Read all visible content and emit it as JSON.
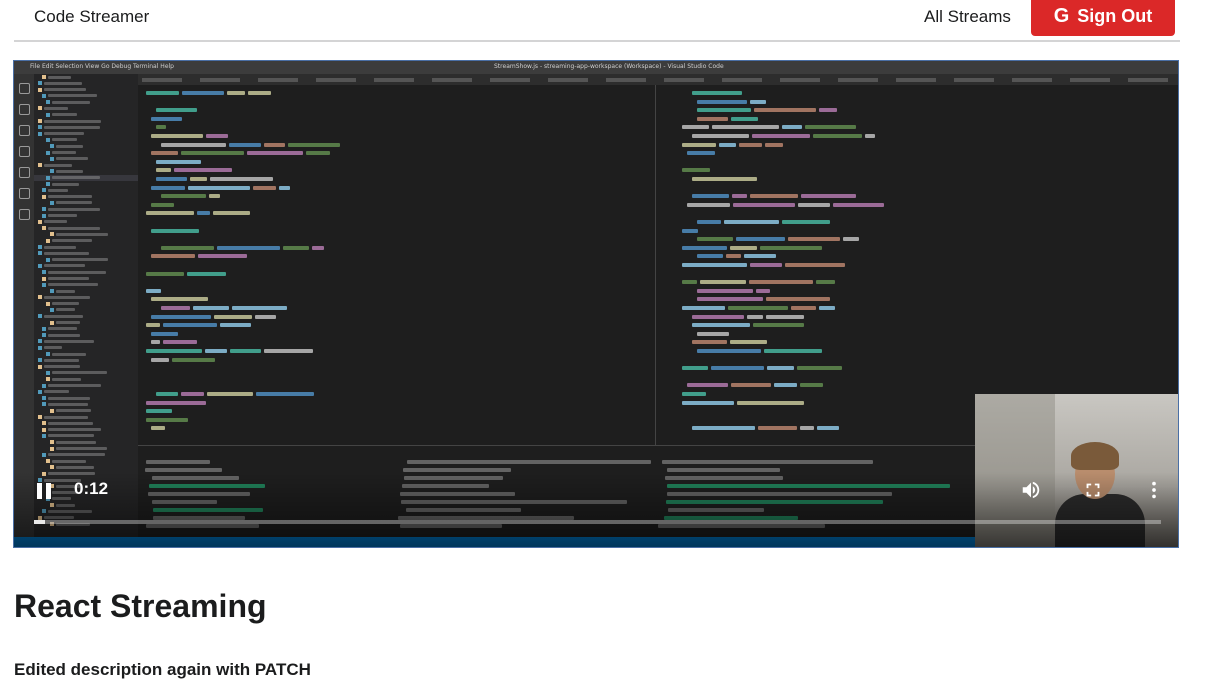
{
  "header": {
    "brand": "Code Streamer",
    "all_streams": "All Streams",
    "sign_out": "Sign Out",
    "sign_out_color": "#db2828"
  },
  "video": {
    "window_title": "StreamShow.js - streaming-app-workspace (Workspace) - Visual Studio Code",
    "menu": [
      "File",
      "Edit",
      "Selection",
      "View",
      "Go",
      "Debug",
      "Terminal",
      "Help"
    ],
    "current_time": "0:12",
    "progress": 0.01,
    "state": "playing",
    "icons": [
      "pause-icon",
      "volume-icon",
      "fullscreen-icon",
      "more-vert-icon"
    ]
  },
  "stream": {
    "title": "React Streaming",
    "description": "Edited description again with PATCH"
  }
}
